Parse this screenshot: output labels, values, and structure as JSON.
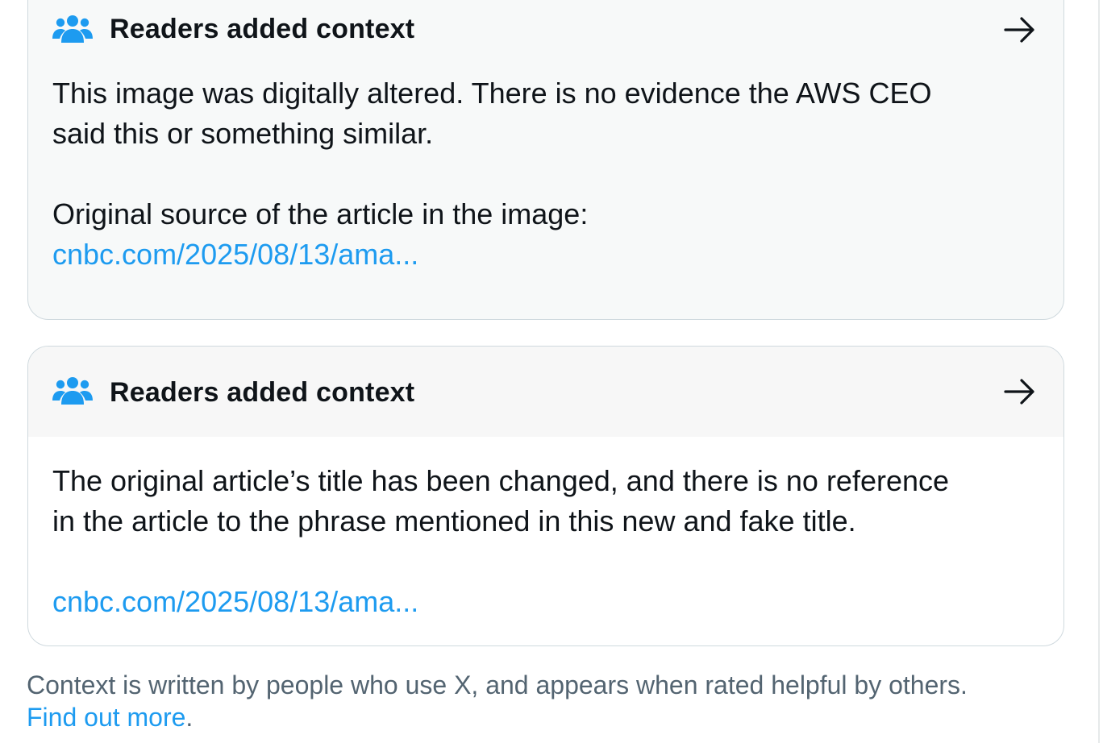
{
  "notes": [
    {
      "title": "Readers added context",
      "icon": "people-icon",
      "body_lines": [
        "This image was digitally altered. There is no evidence the AWS CEO",
        "said this or something similar."
      ],
      "source_label": "Original source of the article in the image:",
      "link": "cnbc.com/2025/08/13/ama..."
    },
    {
      "title": "Readers added context",
      "icon": "people-icon",
      "body_lines": [
        "The original article’s title has been changed, and there is no reference",
        "in the article to the phrase mentioned in this new and fake title."
      ],
      "link": "cnbc.com/2025/08/13/ama..."
    }
  ],
  "footer": {
    "text": "Context is written by people who use X, and appears when rated helpful by others.",
    "link": "Find out more",
    "trailing": "."
  },
  "colors": {
    "accent": "#1d9bf0",
    "text": "#0f1419",
    "muted": "#536471",
    "border": "#cfd9de",
    "header_bg": "#f7f9f9"
  }
}
